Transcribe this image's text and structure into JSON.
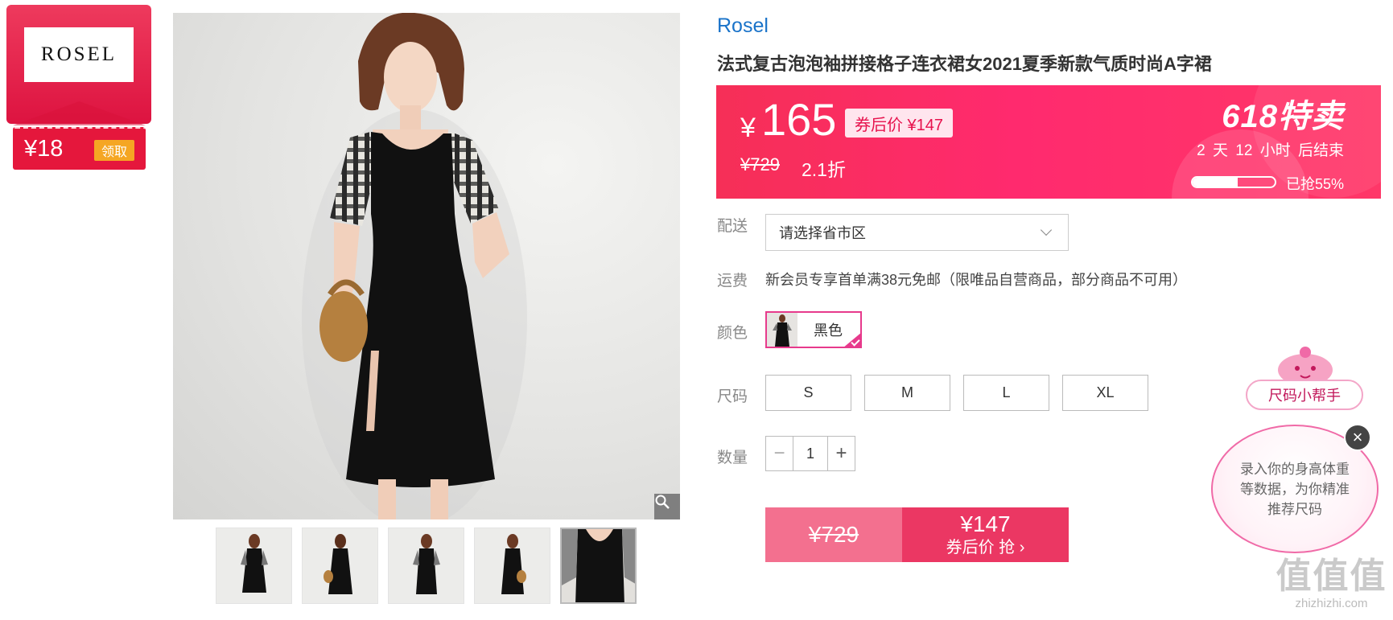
{
  "brand_card": {
    "logo_text": "ROSEL",
    "coupon_amount": "¥18",
    "claim_label": "领取"
  },
  "product": {
    "brand": "Rosel",
    "title": "法式复古泡泡袖拼接格子连衣裙女2021夏季新款气质时尚A字裙"
  },
  "price_banner": {
    "currency": "¥",
    "price": "165",
    "coupon_price_label": "券后价 ¥147",
    "original_price": "¥729",
    "discount": "2.1折",
    "promo_title": "618特卖",
    "countdown": "2 天 12 小时 后结束",
    "sold_percent": 55,
    "sold_label": "已抢55%",
    "colors": {
      "start": "#f62f57",
      "end": "#ff3768"
    }
  },
  "options": {
    "delivery_label": "配送",
    "delivery_placeholder": "请选择省市区",
    "shipping_label": "运费",
    "shipping_text": "新会员专享首单满38元免邮（限唯品自营商品，部分商品不可用）",
    "color_label": "颜色",
    "color_value": "黑色",
    "size_label": "尺码",
    "sizes": [
      "S",
      "M",
      "L",
      "XL"
    ],
    "quantity_label": "数量",
    "quantity": "1",
    "minus": "−",
    "plus": "+"
  },
  "buy_bar": {
    "original_price": "¥729",
    "coupon_price": "¥147",
    "action": "券后价 抢 ›"
  },
  "size_helper": {
    "title": "尺码小帮手",
    "message": "录入你的身高体重等数据，为你精准推荐尺码",
    "close_glyph": "×"
  },
  "watermark": {
    "text": "值值值",
    "domain": "zhizhizhi.com"
  },
  "icons": {
    "zoom": "magnifier-icon",
    "chevron": "chevron-down-icon",
    "close": "close-icon",
    "check": "check-icon"
  },
  "accent_colors": {
    "brand_red": "#e5173c",
    "pink": "#eb3763",
    "link_blue": "#1a73c9",
    "selected": "#e73a8c"
  }
}
